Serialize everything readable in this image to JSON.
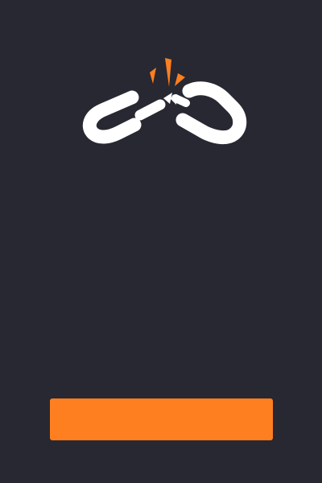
{
  "screen": {
    "background_color": "#272831"
  },
  "illustration": {
    "icon": "broken-link-icon",
    "link_color": "#ffffff",
    "spark_color": "#fd7f20"
  },
  "action_button": {
    "label": "",
    "background_color": "#fd7f20"
  }
}
